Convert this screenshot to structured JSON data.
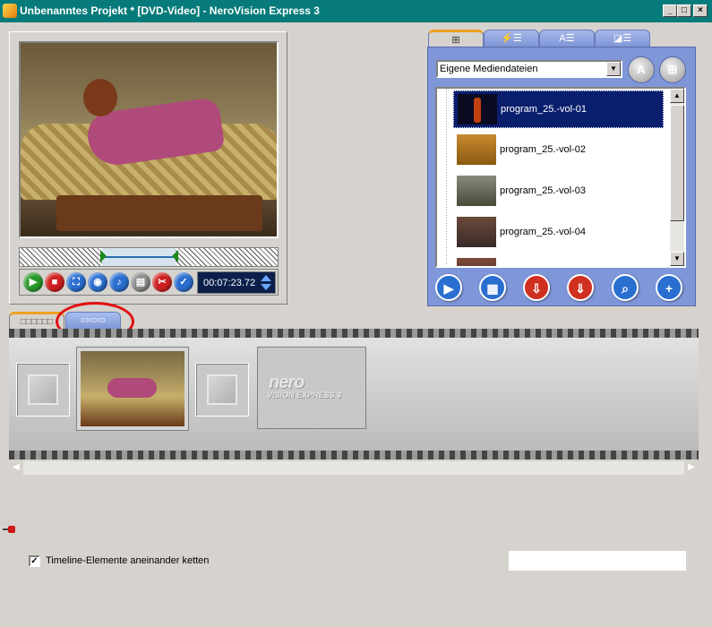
{
  "window": {
    "title": "Unbenanntes Projekt * [DVD-Video] - NeroVision Express 3",
    "minimize": "_",
    "maximize": "□",
    "close": "×"
  },
  "preview": {
    "timecode": "00:07:23.72"
  },
  "media_browser": {
    "tabs": [
      {
        "icon": "film-list-icon",
        "glyph": "⊞"
      },
      {
        "icon": "effects-list-icon",
        "glyph": "⚡☰"
      },
      {
        "icon": "text-effects-icon",
        "glyph": "A☰"
      },
      {
        "icon": "transitions-list-icon",
        "glyph": "◪☰"
      }
    ],
    "folder_select": "Eigene Mediendateien",
    "items": [
      {
        "label": "program_25.-vol-01",
        "selected": true
      },
      {
        "label": "program_25.-vol-02",
        "selected": false
      },
      {
        "label": "program_25.-vol-03",
        "selected": false
      },
      {
        "label": "program_25.-vol-04",
        "selected": false
      }
    ]
  },
  "timeline": {
    "menu_clip_logo": "nero",
    "menu_clip_sub": "VISION EXPRESS 3"
  },
  "options": {
    "chain_label": "Timeline-Elemente aneinander ketten",
    "chain_checked": "✓"
  },
  "colors": {
    "titlebar": "#077b7b",
    "panel_blue": "#7f96d8",
    "highlight_red": "#e01010",
    "selection": "#0a1e6e"
  }
}
